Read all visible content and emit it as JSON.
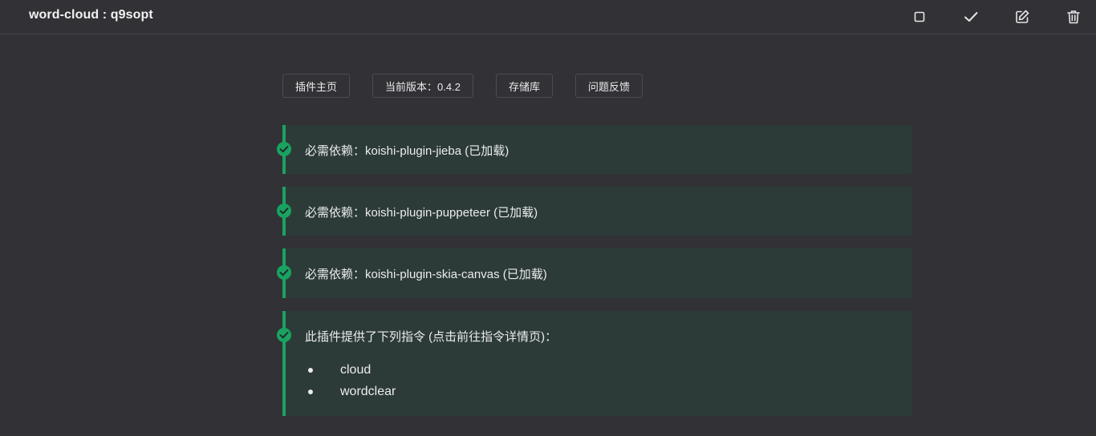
{
  "header": {
    "title": "word-cloud : q9sopt",
    "actions": [
      {
        "name": "stop-icon"
      },
      {
        "name": "check-icon"
      },
      {
        "name": "edit-icon"
      },
      {
        "name": "trash-icon"
      }
    ]
  },
  "links": [
    "插件主页",
    "当前版本：0.4.2",
    "存储库",
    "问题反馈"
  ],
  "dependencies": [
    "必需依赖：koishi-plugin-jieba (已加载)",
    "必需依赖：koishi-plugin-puppeteer (已加载)",
    "必需依赖：koishi-plugin-skia-canvas (已加载)"
  ],
  "commands_card": {
    "intro": "此插件提供了下列指令 (点击前往指令详情页)：",
    "commands": [
      "cloud",
      "wordclear"
    ]
  },
  "colors": {
    "background": "#313136",
    "card_background": "#2c3b38",
    "accent_green": "#1aa260"
  }
}
